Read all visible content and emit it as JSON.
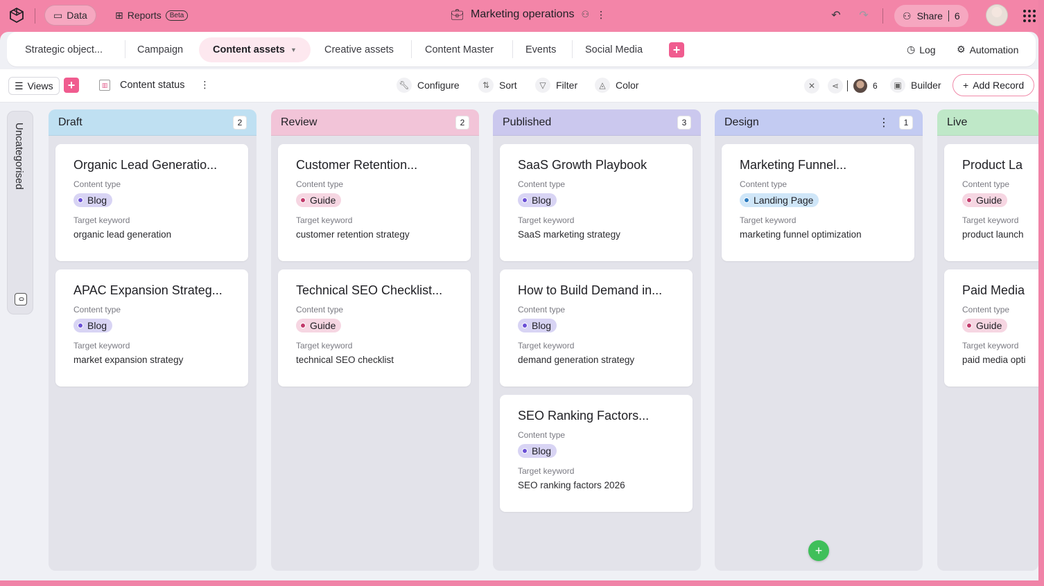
{
  "top": {
    "data_label": "Data",
    "reports_label": "Reports",
    "beta": "Beta",
    "title": "Marketing operations",
    "share_label": "Share",
    "share_count": "6"
  },
  "tabs": [
    {
      "label": "Strategic object..."
    },
    {
      "label": "Campaign"
    },
    {
      "label": "Content assets"
    },
    {
      "label": "Creative assets"
    },
    {
      "label": "Content Master"
    },
    {
      "label": "Events"
    },
    {
      "label": "Social Media"
    }
  ],
  "tabs_right": {
    "log": "Log",
    "automation": "Automation"
  },
  "toolbar": {
    "views": "Views",
    "view_name": "Content status",
    "configure": "Configure",
    "sort": "Sort",
    "filter": "Filter",
    "color": "Color",
    "collab_count": "6",
    "builder": "Builder",
    "add_record": "Add Record"
  },
  "uncategorised": {
    "label": "Uncategorised",
    "count": "0"
  },
  "field_labels": {
    "type": "Content type",
    "keyword": "Target keyword"
  },
  "colors": {
    "draft_head": "#bfe0f2",
    "review_head": "#f2c4d8",
    "published_head": "#cbc8ee",
    "design_head": "#c3cbf2",
    "live_head": "#bfe8c8",
    "blog_chip": "#d8d4f4",
    "guide_chip": "#f6d6e2",
    "landing_chip": "#cfe6f8"
  },
  "columns": [
    {
      "name": "Draft",
      "count": "2",
      "cards": [
        {
          "title": "Organic Lead Generatio...",
          "type": "Blog",
          "keyword": "organic lead generation"
        },
        {
          "title": "APAC Expansion Strateg...",
          "type": "Blog",
          "keyword": "market expansion strategy"
        }
      ]
    },
    {
      "name": "Review",
      "count": "2",
      "cards": [
        {
          "title": "Customer Retention...",
          "type": "Guide",
          "keyword": "customer retention strategy"
        },
        {
          "title": "Technical SEO Checklist...",
          "type": "Guide",
          "keyword": "technical SEO checklist"
        }
      ]
    },
    {
      "name": "Published",
      "count": "3",
      "cards": [
        {
          "title": "SaaS Growth Playbook",
          "type": "Blog",
          "keyword": "SaaS marketing strategy"
        },
        {
          "title": "How to Build Demand in...",
          "type": "Blog",
          "keyword": "demand generation strategy"
        },
        {
          "title": "SEO Ranking Factors...",
          "type": "Blog",
          "keyword": "SEO ranking factors 2026"
        }
      ]
    },
    {
      "name": "Design",
      "count": "1",
      "cards": [
        {
          "title": "Marketing Funnel...",
          "type": "Landing Page",
          "keyword": "marketing funnel optimization"
        }
      ]
    },
    {
      "name": "Live",
      "count": "",
      "cards": [
        {
          "title": "Product La",
          "type": "Guide",
          "keyword": "product launch"
        },
        {
          "title": "Paid Media",
          "type": "Guide",
          "keyword": "paid media opti"
        }
      ]
    }
  ]
}
